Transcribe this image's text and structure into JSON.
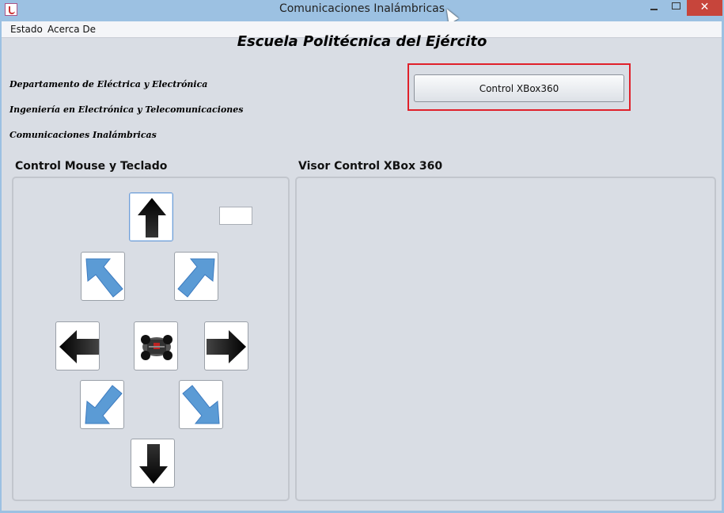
{
  "window": {
    "title": "Comunicaciones Inalámbricas",
    "close_glyph": "✕"
  },
  "menu": {
    "items": [
      "Estado",
      "Acerca De"
    ]
  },
  "header": {
    "title": "Escuela Politécnica del Ejército",
    "lines": [
      "Departamento de Eléctrica y Electrónica",
      "Ingeniería en Electrónica y Telecomunicaciones",
      "Comunicaciones Inalámbricas"
    ]
  },
  "xbox_button": {
    "label": "Control XBox360"
  },
  "left_section": {
    "title": "Control Mouse y Teclado",
    "speed_value": ""
  },
  "right_section": {
    "title": "Visor Control XBox 360"
  },
  "controls": {
    "icons": [
      "arrow-up-icon",
      "arrow-up-left-icon",
      "arrow-up-right-icon",
      "arrow-left-icon",
      "rc-car-icon",
      "arrow-right-icon",
      "arrow-down-left-icon",
      "arrow-down-right-icon",
      "arrow-down-icon"
    ]
  },
  "colors": {
    "highlight": "#e0202a",
    "diagonal_arrow": "#5b9bd5",
    "cardinal_arrow": "#000000"
  }
}
